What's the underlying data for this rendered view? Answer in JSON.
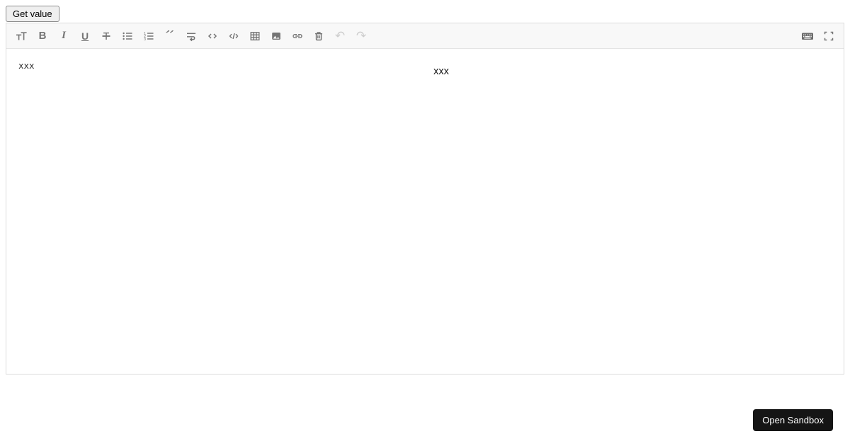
{
  "header": {
    "get_value_label": "Get value"
  },
  "editor": {
    "toolbar": {
      "left_items": [
        "font-size",
        "bold",
        "italic",
        "underline",
        "strikethrough",
        "unordered-list",
        "ordered-list",
        "quote",
        "line-break",
        "inline-code",
        "code-block",
        "table",
        "image",
        "link",
        "delete",
        "undo",
        "redo"
      ],
      "right_items": [
        "keyboard",
        "fullscreen"
      ],
      "glyphs": {
        "bold": "B",
        "italic": "I",
        "underline": "U",
        "quote": "”",
        "undo": "↶",
        "redo": "↷"
      },
      "disabled_items": [
        "undo",
        "redo"
      ]
    },
    "content": {
      "source_text": "xxx",
      "preview_text": "xxx"
    }
  },
  "footer": {
    "open_sandbox_label": "Open Sandbox"
  },
  "colors": {
    "icon": "#757575",
    "icon_disabled": "#cdcdcd",
    "toolbar_bg": "#f8f8f8",
    "border": "#dcdcdc",
    "sandbox_button_bg": "#151515",
    "sandbox_button_text": "#ffffff"
  }
}
